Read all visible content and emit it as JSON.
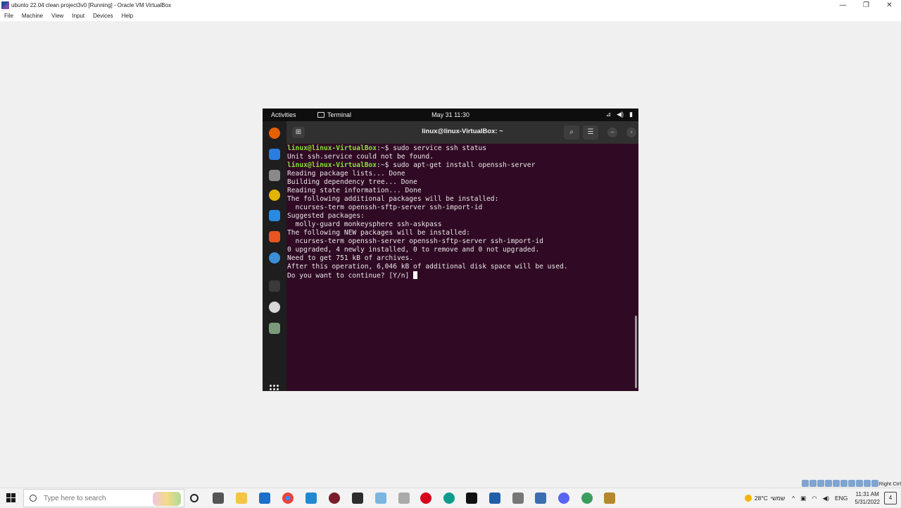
{
  "host": {
    "window_title": "ubunto 22.04 clean project3v0 [Running] - Oracle VM VirtualBox",
    "menu": [
      "File",
      "Machine",
      "View",
      "Input",
      "Devices",
      "Help"
    ],
    "window_controls": [
      "—",
      "❐",
      "✕"
    ],
    "status_host_key": "Right Ctrl"
  },
  "guest": {
    "topbar": {
      "activities": "Activities",
      "app_name": "Terminal",
      "clock": "May 31  11:30"
    },
    "terminal": {
      "title": "linux@linux-VirtualBox: ~",
      "lines": [
        {
          "prompt": "linux@linux-VirtualBox",
          "suffix": ":~$ ",
          "text": "sudo service ssh status"
        },
        {
          "text": "Unit ssh.service could not be found."
        },
        {
          "prompt": "linux@linux-VirtualBox",
          "suffix": ":~$ ",
          "text": "sudo apt-get install openssh-server"
        },
        {
          "text": "Reading package lists... Done"
        },
        {
          "text": "Building dependency tree... Done"
        },
        {
          "text": "Reading state information... Done"
        },
        {
          "text": "The following additional packages will be installed:"
        },
        {
          "text": "  ncurses-term openssh-sftp-server ssh-import-id"
        },
        {
          "text": "Suggested packages:"
        },
        {
          "text": "  molly-guard monkeysphere ssh-askpass"
        },
        {
          "text": "The following NEW packages will be installed:"
        },
        {
          "text": "  ncurses-term openssh-server openssh-sftp-server ssh-import-id"
        },
        {
          "text": "0 upgraded, 4 newly installed, 0 to remove and 0 not upgraded."
        },
        {
          "text": "Need to get 751 kB of archives."
        },
        {
          "text": "After this operation, 6,046 kB of additional disk space will be used."
        },
        {
          "text": "Do you want to continue? [Y/n] "
        }
      ]
    },
    "dock": [
      {
        "name": "firefox-icon",
        "color": "#e66000"
      },
      {
        "name": "thunderbird-icon",
        "color": "#2a7de1"
      },
      {
        "name": "files-icon",
        "color": "#8a8a8a"
      },
      {
        "name": "rhythmbox-icon",
        "color": "#e0b400"
      },
      {
        "name": "writer-icon",
        "color": "#2a8ae1"
      },
      {
        "name": "software-icon",
        "color": "#e95420"
      },
      {
        "name": "help-icon",
        "color": "#3b8fd6"
      },
      {
        "name": "terminal-icon",
        "color": "#3a3a3a"
      },
      {
        "name": "disc-icon",
        "color": "#d8d8d8"
      },
      {
        "name": "trash-icon",
        "color": "#7a9a7a"
      }
    ]
  },
  "taskbar": {
    "search_placeholder": "Type here to search",
    "temperature": "28°C",
    "weather_label": "שמשי",
    "language": "ENG",
    "time": "11:31 AM",
    "date": "5/31/2022",
    "notification_count": "4"
  }
}
